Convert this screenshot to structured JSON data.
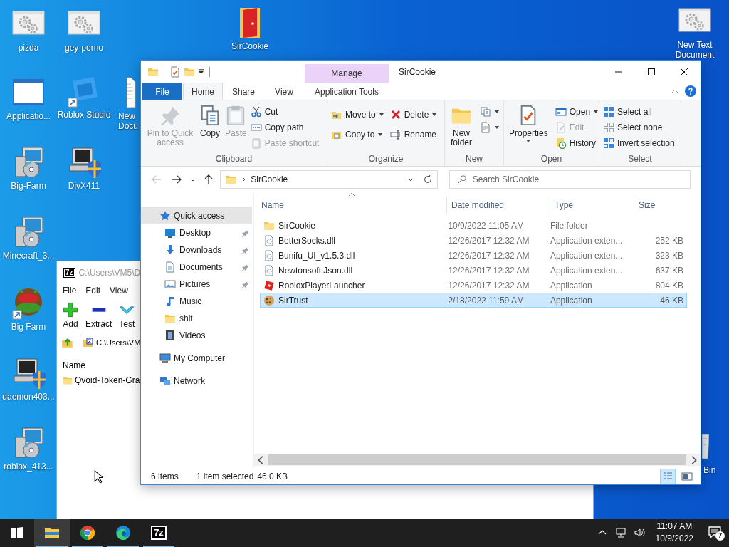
{
  "desktop": {
    "icons": [
      {
        "label": "pizda",
        "kind": "gears-window",
        "shortcut": false
      },
      {
        "label": "gey-porno",
        "kind": "gears-window",
        "shortcut": false
      },
      {
        "label": "SirCookie",
        "kind": "red-folder",
        "shortcut": false
      },
      {
        "label": "New Text Document",
        "kind": "gears-window",
        "shortcut": false
      },
      {
        "label": "Applicatio...",
        "kind": "blank-window",
        "shortcut": false
      },
      {
        "label": "Roblox Studio",
        "kind": "blue-tile",
        "shortcut": true
      },
      {
        "label": "New Docu",
        "kind": "text-document"
      },
      {
        "label": "Big-Farm",
        "kind": "installer",
        "shortcut": false
      },
      {
        "label": "DivX411",
        "kind": "installer-shield",
        "shortcut": false
      },
      {
        "label": "Minecraft_3...",
        "kind": "installer",
        "shortcut": false
      },
      {
        "label": "Big Farm",
        "kind": "farm-logo",
        "shortcut": true
      },
      {
        "label": "daemon403...",
        "kind": "installer-shield",
        "shortcut": false
      },
      {
        "label": "roblox_413...",
        "kind": "installer",
        "shortcut": false
      },
      {
        "label": "Bin",
        "kind": "recycle-bin",
        "shortcut": false
      }
    ]
  },
  "archiver": {
    "icon_label": "7z",
    "title": "C:\\Users\\VM5\\D",
    "menu": [
      "File",
      "Edit",
      "View"
    ],
    "toolbar": [
      {
        "label": "Add",
        "kind": "add"
      },
      {
        "label": "Extract",
        "kind": "extract"
      },
      {
        "label": "Test",
        "kind": "test"
      }
    ],
    "address": "C:\\Users\\VM",
    "column": "Name",
    "rows": [
      {
        "name": "Qvoid-Token-Gra",
        "kind": "folder"
      }
    ]
  },
  "explorer": {
    "context_tab": "Manage",
    "title": "SirCookie",
    "tabs": [
      {
        "label": "File",
        "kind": "file",
        "selected": false
      },
      {
        "label": "Home",
        "kind": "tab",
        "selected": true
      },
      {
        "label": "Share",
        "kind": "tab",
        "selected": false
      },
      {
        "label": "View",
        "kind": "tab",
        "selected": false
      },
      {
        "label": "Application Tools",
        "kind": "context",
        "selected": false
      }
    ],
    "ribbon": [
      {
        "name": "Clipboard",
        "columns": [
          {
            "kind": "large",
            "items": [
              {
                "label": "Pin to Quick access",
                "kind": "pin",
                "disabled": true,
                "dropdown": false
              },
              {
                "label": "Copy",
                "kind": "copy",
                "disabled": false,
                "dropdown": false
              },
              {
                "label": "Paste",
                "kind": "paste",
                "disabled": true,
                "dropdown": false
              }
            ]
          },
          {
            "kind": "small",
            "items": [
              {
                "label": "Cut",
                "kind": "cut",
                "disabled": false,
                "dropdown": false
              },
              {
                "label": "Copy path",
                "kind": "copy-path",
                "disabled": false,
                "dropdown": false
              },
              {
                "label": "Paste shortcut",
                "kind": "paste-shortcut",
                "disabled": true,
                "dropdown": false
              }
            ]
          }
        ]
      },
      {
        "name": "Organize",
        "columns": [
          {
            "kind": "small",
            "items": [
              {
                "label": "Move to",
                "kind": "move-to",
                "disabled": false,
                "dropdown": true
              },
              {
                "label": "Copy to",
                "kind": "copy-to",
                "disabled": false,
                "dropdown": true
              }
            ]
          },
          {
            "kind": "small",
            "items": [
              {
                "label": "Delete",
                "kind": "delete",
                "disabled": false,
                "dropdown": true
              },
              {
                "label": "Rename",
                "kind": "rename",
                "disabled": false,
                "dropdown": false
              }
            ]
          }
        ]
      },
      {
        "name": "New",
        "columns": [
          {
            "kind": "large",
            "items": [
              {
                "label": "New folder",
                "kind": "new-folder",
                "disabled": false,
                "dropdown": false
              }
            ]
          },
          {
            "kind": "small",
            "items": [
              {
                "kind": "new-item",
                "disabled": false,
                "dropdown": true
              },
              {
                "kind": "easy-access",
                "disabled": false,
                "dropdown": true
              }
            ]
          }
        ]
      },
      {
        "name": "Open",
        "columns": [
          {
            "kind": "large",
            "items": [
              {
                "label": "Properties",
                "kind": "properties",
                "disabled": false,
                "dropdown": true
              }
            ]
          },
          {
            "kind": "small",
            "items": [
              {
                "label": "Open",
                "kind": "open",
                "disabled": false,
                "dropdown": true
              },
              {
                "label": "Edit",
                "kind": "edit",
                "disabled": true,
                "dropdown": false
              },
              {
                "label": "History",
                "kind": "history",
                "disabled": false,
                "dropdown": false
              }
            ]
          }
        ]
      },
      {
        "name": "Select",
        "columns": [
          {
            "kind": "small",
            "items": [
              {
                "label": "Select all",
                "kind": "select-all",
                "disabled": false,
                "dropdown": false
              },
              {
                "label": "Select none",
                "kind": "select-none",
                "disabled": false,
                "dropdown": false
              },
              {
                "label": "Invert selection",
                "kind": "invert",
                "disabled": false,
                "dropdown": false
              }
            ]
          }
        ]
      }
    ],
    "back_disabled": true,
    "address": "SirCookie",
    "search": {
      "placeholder": "Search SirCookie"
    },
    "nav_pane": [
      {
        "label": "Quick access",
        "kind": "star",
        "selected": true,
        "children": [
          {
            "label": "Desktop",
            "kind": "monitor",
            "pinned": true,
            "selected": false
          },
          {
            "label": "Downloads",
            "kind": "download",
            "pinned": true,
            "selected": false
          },
          {
            "label": "Documents",
            "kind": "document",
            "pinned": true,
            "selected": false
          },
          {
            "label": "Pictures",
            "kind": "picture",
            "pinned": true,
            "selected": false
          },
          {
            "label": "Music",
            "kind": "music",
            "pinned": false,
            "selected": false
          },
          {
            "label": "shit",
            "kind": "folder",
            "pinned": false,
            "selected": false
          },
          {
            "label": "Videos",
            "kind": "film",
            "pinned": false,
            "selected": false
          }
        ]
      },
      {
        "label": "My Computer",
        "kind": "computer",
        "selected": false
      },
      {
        "label": "Network",
        "kind": "network",
        "selected": false
      }
    ],
    "columns": [
      {
        "label": "Name",
        "sorted": true
      },
      {
        "label": "Date modified",
        "sorted": false
      },
      {
        "label": "Type",
        "sorted": false
      },
      {
        "label": "Size",
        "sorted": false
      }
    ],
    "files": [
      {
        "name": "SirCookie",
        "kind": "folder",
        "date": "10/9/2022 11:05 AM",
        "type": "File folder",
        "selected": false
      },
      {
        "name": "BetterSocks.dll",
        "kind": "dll",
        "date": "12/26/2017 12:32 AM",
        "type": "Application exten...",
        "size": "252 KB",
        "selected": false
      },
      {
        "name": "Bunifu_UI_v1.5.3.dll",
        "kind": "dll",
        "date": "12/26/2017 12:32 AM",
        "type": "Application exten...",
        "size": "323 KB",
        "selected": false
      },
      {
        "name": "Newtonsoft.Json.dll",
        "kind": "dll",
        "date": "12/26/2017 12:32 AM",
        "type": "Application exten...",
        "size": "637 KB",
        "selected": false
      },
      {
        "name": "RobloxPlayerLauncher",
        "kind": "tilted-square",
        "date": "12/26/2017 12:32 AM",
        "type": "Application",
        "size": "804 KB",
        "selected": false
      },
      {
        "name": "SirTrust",
        "kind": "cookie",
        "date": "2/18/2022 11:59 AM",
        "type": "Application",
        "size": "46 KB",
        "selected": true
      }
    ],
    "status": {
      "count": "6 items",
      "selection": "1 item selected",
      "size": "46.0 KB"
    },
    "view_buttons": [
      {
        "kind": "details",
        "selected": true
      },
      {
        "kind": "large-icons",
        "selected": false
      }
    ]
  },
  "taskbar": {
    "apps": [
      {
        "kind": "explorer",
        "selected": true
      },
      {
        "kind": "chrome",
        "selected": false
      },
      {
        "kind": "edge",
        "selected": false
      },
      {
        "kind": "archiver",
        "label": "7z",
        "selected": false
      }
    ],
    "time": "11:07 AM",
    "date": "10/9/2022",
    "notifications": "7"
  }
}
